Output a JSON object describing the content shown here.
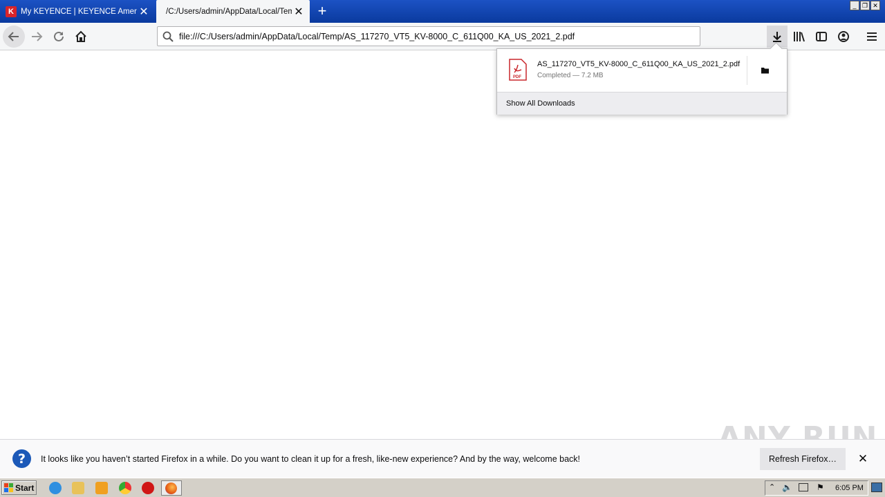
{
  "window": {
    "tabs": [
      {
        "title": "My KEYENCE | KEYENCE America",
        "active": false,
        "favicon": "K"
      },
      {
        "title": "/C:/Users/admin/AppData/Local/Temp/",
        "active": true
      }
    ],
    "controls": [
      "_",
      "❐",
      "✕"
    ]
  },
  "navbar": {
    "url": "file:///C:/Users/admin/AppData/Local/Temp/AS_117270_VT5_KV-8000_C_611Q00_KA_US_2021_2.pdf"
  },
  "downloads_panel": {
    "item": {
      "filename": "AS_117270_VT5_KV-8000_C_611Q00_KA_US_2021_2.pdf",
      "status": "Completed — 7.2 MB",
      "icon_label": "PDF"
    },
    "footer": "Show All Downloads"
  },
  "notification": {
    "text": "It looks like you haven’t started Firefox in a while. Do you want to clean it up for a fresh, like-new experience? And by the way, welcome back!",
    "button": "Refresh Firefox…"
  },
  "watermark": "ANY RUN",
  "taskbar": {
    "start_label": "Start",
    "clock": "6:05 PM"
  }
}
